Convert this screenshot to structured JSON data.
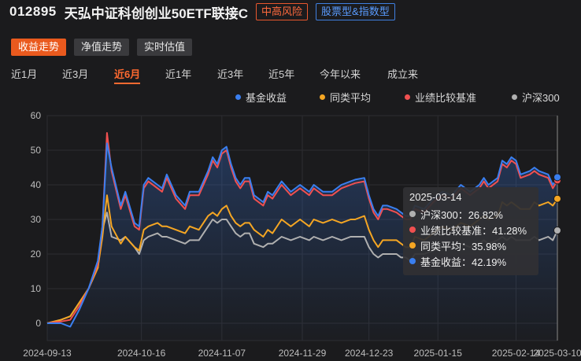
{
  "header": {
    "fund_code": "012895",
    "fund_name": "天弘中证科创创业50ETF联接C",
    "risk_tag": "中高风险",
    "type_tag": "股票型&指数型"
  },
  "modes": [
    {
      "label": "收益走势",
      "active": true
    },
    {
      "label": "净值走势",
      "active": false
    },
    {
      "label": "实时估值",
      "active": false
    }
  ],
  "ranges": [
    {
      "label": "近1月",
      "active": false
    },
    {
      "label": "近3月",
      "active": false
    },
    {
      "label": "近6月",
      "active": true
    },
    {
      "label": "近1年",
      "active": false
    },
    {
      "label": "近3年",
      "active": false
    },
    {
      "label": "近5年",
      "active": false
    },
    {
      "label": "今年以来",
      "active": false
    },
    {
      "label": "成立来",
      "active": false
    }
  ],
  "tooltip": {
    "date": "2025-03-14",
    "rows": [
      {
        "label": "沪深300：26.82%",
        "color": "#b0b0b0"
      },
      {
        "label": "业绩比较基准：41.28%",
        "color": "#f05050"
      },
      {
        "label": "同类平均：35.98%",
        "color": "#f5a623"
      },
      {
        "label": "基金收益：42.19%",
        "color": "#3a7ff0"
      }
    ]
  },
  "chart_data": {
    "type": "line",
    "ylim": [
      0,
      60
    ],
    "yticks": [
      "60",
      "50",
      "40",
      "30",
      "20",
      "10",
      "0"
    ],
    "xticks": [
      "2024-09-13",
      "2024-10-16",
      "2024-11-07",
      "2024-11-29",
      "2024-12-23",
      "2025-01-15",
      "2025-02-14",
      "2025-03-10"
    ],
    "series": [
      {
        "name": "基金收益",
        "color": "#3a7ff0",
        "points": [
          [
            0,
            0
          ],
          [
            3,
            0
          ],
          [
            5,
            -1
          ],
          [
            7,
            4
          ],
          [
            9,
            10
          ],
          [
            11,
            18
          ],
          [
            12,
            28
          ],
          [
            13,
            52
          ],
          [
            14,
            45
          ],
          [
            16,
            34
          ],
          [
            17,
            38
          ],
          [
            19,
            29
          ],
          [
            20,
            28
          ],
          [
            21,
            40
          ],
          [
            22,
            42
          ],
          [
            24,
            40
          ],
          [
            25,
            39
          ],
          [
            26,
            43
          ],
          [
            28,
            37
          ],
          [
            30,
            34
          ],
          [
            31,
            38
          ],
          [
            33,
            38
          ],
          [
            35,
            44
          ],
          [
            36,
            48
          ],
          [
            37,
            46
          ],
          [
            38,
            50
          ],
          [
            39,
            51
          ],
          [
            40,
            46
          ],
          [
            41,
            42
          ],
          [
            42,
            40
          ],
          [
            43,
            42
          ],
          [
            44,
            42
          ],
          [
            45,
            37
          ],
          [
            47,
            35
          ],
          [
            48,
            38
          ],
          [
            49,
            37
          ],
          [
            51,
            41
          ],
          [
            53,
            38
          ],
          [
            55,
            40
          ],
          [
            57,
            38
          ],
          [
            58,
            40
          ],
          [
            60,
            38
          ],
          [
            62,
            38
          ],
          [
            64,
            40
          ],
          [
            66,
            41
          ],
          [
            67,
            41.5
          ],
          [
            69,
            42
          ],
          [
            70,
            37
          ],
          [
            71,
            33
          ],
          [
            72,
            31
          ],
          [
            73,
            34
          ],
          [
            74,
            34
          ],
          [
            76,
            33
          ],
          [
            77,
            32
          ],
          [
            78,
            31
          ],
          [
            79,
            31
          ],
          [
            80,
            34
          ],
          [
            82,
            33
          ],
          [
            84,
            36
          ],
          [
            86,
            38
          ],
          [
            88,
            37
          ],
          [
            90,
            40
          ],
          [
            92,
            38
          ],
          [
            94,
            40
          ],
          [
            95,
            42
          ],
          [
            96,
            40
          ],
          [
            98,
            42
          ],
          [
            99,
            47
          ],
          [
            100,
            46
          ],
          [
            101,
            48
          ],
          [
            102,
            47
          ],
          [
            103,
            43
          ],
          [
            105,
            44
          ],
          [
            106,
            45
          ],
          [
            107,
            44
          ],
          [
            109,
            43
          ],
          [
            110,
            40
          ],
          [
            111,
            42.19
          ]
        ]
      },
      {
        "name": "业绩比较基准",
        "color": "#f05050",
        "points": [
          [
            0,
            0
          ],
          [
            3,
            0.5
          ],
          [
            5,
            1
          ],
          [
            7,
            5
          ],
          [
            9,
            10
          ],
          [
            11,
            17
          ],
          [
            12,
            28
          ],
          [
            13,
            55
          ],
          [
            14,
            44
          ],
          [
            16,
            33
          ],
          [
            17,
            37
          ],
          [
            19,
            28
          ],
          [
            20,
            27
          ],
          [
            21,
            39
          ],
          [
            22,
            41
          ],
          [
            24,
            39
          ],
          [
            25,
            38
          ],
          [
            26,
            42
          ],
          [
            28,
            36
          ],
          [
            30,
            33
          ],
          [
            31,
            37
          ],
          [
            33,
            37
          ],
          [
            35,
            43
          ],
          [
            36,
            47
          ],
          [
            37,
            45
          ],
          [
            38,
            49
          ],
          [
            39,
            50
          ],
          [
            40,
            45
          ],
          [
            41,
            41
          ],
          [
            42,
            39
          ],
          [
            43,
            41
          ],
          [
            44,
            41
          ],
          [
            45,
            36
          ],
          [
            47,
            34
          ],
          [
            48,
            37
          ],
          [
            49,
            36
          ],
          [
            51,
            40
          ],
          [
            53,
            37
          ],
          [
            55,
            39
          ],
          [
            57,
            37
          ],
          [
            58,
            39
          ],
          [
            60,
            37
          ],
          [
            62,
            37
          ],
          [
            64,
            39
          ],
          [
            66,
            40
          ],
          [
            67,
            40.5
          ],
          [
            69,
            41
          ],
          [
            70,
            36
          ],
          [
            71,
            32
          ],
          [
            72,
            30
          ],
          [
            73,
            33
          ],
          [
            74,
            33
          ],
          [
            76,
            32
          ],
          [
            77,
            31
          ],
          [
            78,
            30
          ],
          [
            79,
            30
          ],
          [
            80,
            33
          ],
          [
            82,
            32
          ],
          [
            84,
            35
          ],
          [
            86,
            37
          ],
          [
            88,
            36
          ],
          [
            90,
            39
          ],
          [
            92,
            37
          ],
          [
            94,
            39
          ],
          [
            95,
            41
          ],
          [
            96,
            39
          ],
          [
            98,
            41
          ],
          [
            99,
            46
          ],
          [
            100,
            45
          ],
          [
            101,
            47
          ],
          [
            102,
            46
          ],
          [
            103,
            42
          ],
          [
            105,
            43
          ],
          [
            106,
            44
          ],
          [
            107,
            43
          ],
          [
            109,
            42
          ],
          [
            110,
            39
          ],
          [
            111,
            41.28
          ]
        ]
      },
      {
        "name": "同类平均",
        "color": "#f5a623",
        "points": [
          [
            0,
            0
          ],
          [
            3,
            1
          ],
          [
            5,
            2
          ],
          [
            7,
            6
          ],
          [
            9,
            10
          ],
          [
            11,
            16
          ],
          [
            12,
            25
          ],
          [
            13,
            37
          ],
          [
            14,
            28
          ],
          [
            16,
            23
          ],
          [
            17,
            25
          ],
          [
            19,
            22
          ],
          [
            20,
            21
          ],
          [
            21,
            27
          ],
          [
            22,
            28
          ],
          [
            24,
            29
          ],
          [
            25,
            28
          ],
          [
            26,
            28
          ],
          [
            28,
            27
          ],
          [
            30,
            26
          ],
          [
            31,
            28
          ],
          [
            33,
            27
          ],
          [
            35,
            31
          ],
          [
            36,
            32
          ],
          [
            37,
            31
          ],
          [
            38,
            33
          ],
          [
            39,
            34
          ],
          [
            40,
            31
          ],
          [
            41,
            29
          ],
          [
            42,
            28
          ],
          [
            43,
            29
          ],
          [
            44,
            29
          ],
          [
            45,
            27
          ],
          [
            47,
            25
          ],
          [
            48,
            27
          ],
          [
            49,
            26
          ],
          [
            51,
            30
          ],
          [
            53,
            28
          ],
          [
            55,
            30
          ],
          [
            57,
            28
          ],
          [
            58,
            30
          ],
          [
            60,
            29
          ],
          [
            62,
            30
          ],
          [
            64,
            29
          ],
          [
            66,
            30
          ],
          [
            67,
            30
          ],
          [
            69,
            31
          ],
          [
            70,
            27
          ],
          [
            71,
            24
          ],
          [
            72,
            22
          ],
          [
            73,
            24
          ],
          [
            74,
            24
          ],
          [
            76,
            24
          ],
          [
            77,
            23
          ],
          [
            78,
            22
          ],
          [
            79,
            22
          ],
          [
            80,
            25
          ],
          [
            82,
            24
          ],
          [
            84,
            26
          ],
          [
            86,
            28
          ],
          [
            88,
            27
          ],
          [
            90,
            29
          ],
          [
            92,
            28
          ],
          [
            94,
            30
          ],
          [
            95,
            31
          ],
          [
            96,
            30
          ],
          [
            98,
            31
          ],
          [
            99,
            35
          ],
          [
            100,
            34
          ],
          [
            101,
            35
          ],
          [
            102,
            34
          ],
          [
            103,
            33
          ],
          [
            105,
            33
          ],
          [
            106,
            35
          ],
          [
            107,
            34
          ],
          [
            109,
            35
          ],
          [
            110,
            34
          ],
          [
            111,
            35.98
          ]
        ]
      },
      {
        "name": "沪深300",
        "color": "#b0b0b0",
        "points": [
          [
            0,
            0
          ],
          [
            3,
            1
          ],
          [
            5,
            2
          ],
          [
            7,
            6
          ],
          [
            9,
            10
          ],
          [
            11,
            16
          ],
          [
            12,
            27
          ],
          [
            13,
            32
          ],
          [
            14,
            25
          ],
          [
            16,
            24
          ],
          [
            17,
            25
          ],
          [
            19,
            22
          ],
          [
            20,
            20
          ],
          [
            21,
            24
          ],
          [
            22,
            25
          ],
          [
            24,
            26
          ],
          [
            25,
            25
          ],
          [
            26,
            25
          ],
          [
            28,
            24
          ],
          [
            30,
            23
          ],
          [
            31,
            24
          ],
          [
            33,
            24
          ],
          [
            35,
            28
          ],
          [
            36,
            30
          ],
          [
            37,
            29
          ],
          [
            38,
            30
          ],
          [
            39,
            30
          ],
          [
            40,
            28
          ],
          [
            41,
            26
          ],
          [
            42,
            25
          ],
          [
            43,
            26
          ],
          [
            44,
            26
          ],
          [
            45,
            23
          ],
          [
            47,
            22
          ],
          [
            48,
            23
          ],
          [
            49,
            23
          ],
          [
            51,
            25
          ],
          [
            53,
            24
          ],
          [
            55,
            25
          ],
          [
            57,
            24
          ],
          [
            58,
            25
          ],
          [
            60,
            24
          ],
          [
            62,
            25
          ],
          [
            64,
            24
          ],
          [
            66,
            25
          ],
          [
            67,
            25
          ],
          [
            69,
            25
          ],
          [
            70,
            22
          ],
          [
            71,
            20
          ],
          [
            72,
            19
          ],
          [
            73,
            20
          ],
          [
            74,
            20
          ],
          [
            76,
            20
          ],
          [
            77,
            19
          ],
          [
            78,
            19
          ],
          [
            79,
            18
          ],
          [
            80,
            20
          ],
          [
            82,
            20
          ],
          [
            84,
            21
          ],
          [
            86,
            22
          ],
          [
            88,
            22
          ],
          [
            90,
            23
          ],
          [
            92,
            22
          ],
          [
            94,
            23
          ],
          [
            95,
            24
          ],
          [
            96,
            23
          ],
          [
            98,
            24
          ],
          [
            99,
            25
          ],
          [
            100,
            24
          ],
          [
            101,
            25
          ],
          [
            102,
            24
          ],
          [
            103,
            24
          ],
          [
            105,
            24
          ],
          [
            106,
            25
          ],
          [
            107,
            24
          ],
          [
            109,
            25
          ],
          [
            110,
            24
          ],
          [
            111,
            26.82
          ]
        ]
      }
    ]
  }
}
